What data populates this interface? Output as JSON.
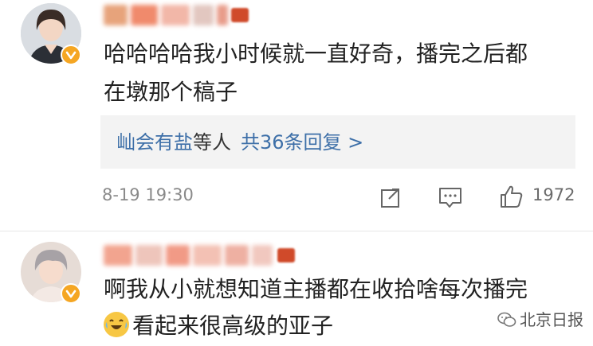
{
  "comments": [
    {
      "text_line1": "哈哈哈哈我小时候就一直好奇，播完之后都",
      "text_line2": "在墩那个稿子",
      "reply_summary": {
        "user": "屾会有盐",
        "middle": "等人",
        "count_label": "共36条回复 >"
      },
      "timestamp": "8-19 19:30",
      "likes": "1972"
    },
    {
      "text_line1": "啊我从小就想知道主播都在收拾啥每次播完",
      "text_line2": "看起来很高级的亚子"
    }
  ],
  "watermark": "北京日报",
  "icons": [
    "share-icon",
    "comment-icon",
    "like-icon",
    "verified-badge-icon",
    "laughing-crying-emoji",
    "wechat-logo-icon"
  ],
  "colors": {
    "link_blue": "#3d6fa8",
    "verified_orange": "#f5a623",
    "meta_gray": "#8a8a8a"
  }
}
